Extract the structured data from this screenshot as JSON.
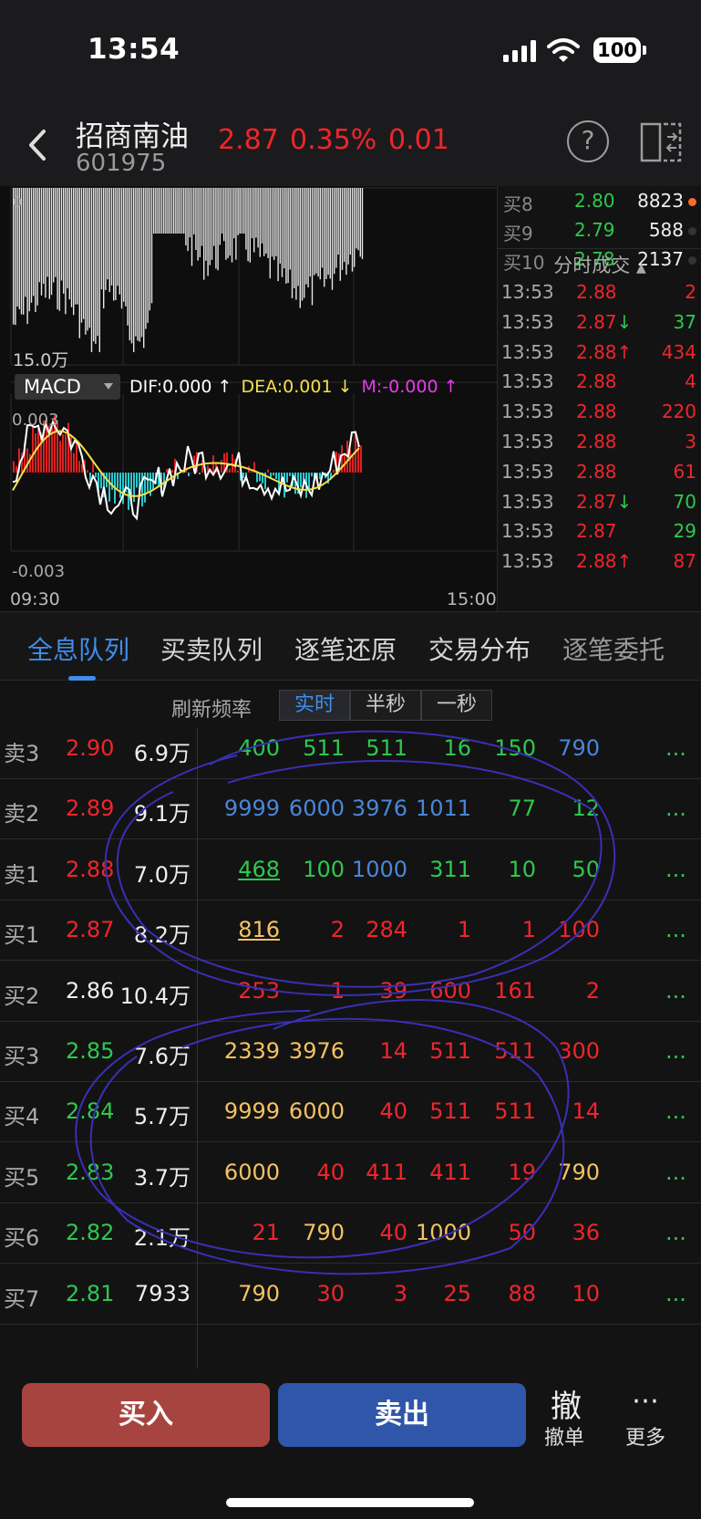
{
  "status_bar": {
    "time": "13:54",
    "battery": "100"
  },
  "header": {
    "stock_name": "招商南油",
    "stock_code": "601975",
    "price": "2.87",
    "change_pct": "0.35%",
    "change": "0.01"
  },
  "chart": {
    "volume_label": "15.0万",
    "volume_zero": "0",
    "macd_select": "MACD",
    "dif": "DIF:0.000 ↑",
    "dea": "DEA:0.001 ↓",
    "m": "M:-0.000 ↑",
    "macd_top": "0.003",
    "macd_bottom": "-0.003",
    "time_start": "09:30",
    "time_end": "15:00",
    "colors": {
      "dif": "#ffffff",
      "dea": "#f4e04a",
      "m": "#e83be8",
      "up": "#e02020",
      "down": "#28c8d0"
    }
  },
  "order_book_top": [
    {
      "label": "买8",
      "price": "2.80",
      "volume": "8823",
      "dot": "#ff6a2a"
    },
    {
      "label": "买9",
      "price": "2.79",
      "volume": "588",
      "dot": "#333333"
    },
    {
      "label": "买10",
      "price": "2.78",
      "volume": "2137",
      "dot": "#333333"
    }
  ],
  "ticks": {
    "title": "分时成交",
    "rows": [
      {
        "time": "13:53",
        "price": "2.88",
        "arrow": "",
        "amount": "2",
        "dir": "up"
      },
      {
        "time": "13:53",
        "price": "2.87↓",
        "arrow": "",
        "amount": "37",
        "dir": "down"
      },
      {
        "time": "13:53",
        "price": "2.88↑",
        "arrow": "",
        "amount": "434",
        "dir": "up"
      },
      {
        "time": "13:53",
        "price": "2.88",
        "arrow": "",
        "amount": "4",
        "dir": "up"
      },
      {
        "time": "13:53",
        "price": "2.88",
        "arrow": "",
        "amount": "220",
        "dir": "up"
      },
      {
        "time": "13:53",
        "price": "2.88",
        "arrow": "",
        "amount": "3",
        "dir": "up"
      },
      {
        "time": "13:53",
        "price": "2.88",
        "arrow": "",
        "amount": "61",
        "dir": "up"
      },
      {
        "time": "13:53",
        "price": "2.87↓",
        "arrow": "",
        "amount": "70",
        "dir": "down"
      },
      {
        "time": "13:53",
        "price": "2.87",
        "arrow": "",
        "amount": "29",
        "dir": "down"
      },
      {
        "time": "13:53",
        "price": "2.88↑",
        "arrow": "",
        "amount": "87",
        "dir": "up"
      }
    ]
  },
  "tabs": [
    "全息队列",
    "买卖队列",
    "逐笔还原",
    "交易分布",
    "逐笔委托"
  ],
  "refresh": {
    "label": "刷新频率",
    "options": [
      "实时",
      "半秒",
      "一秒"
    ]
  },
  "queue": [
    {
      "label": "卖3",
      "price": "2.90",
      "pc": "cr",
      "vol": "6.9万",
      "cells": [
        [
          "400",
          "cg"
        ],
        [
          "511",
          "cg"
        ],
        [
          "511",
          "cg"
        ],
        [
          "16",
          "cg"
        ],
        [
          "150",
          "cg"
        ],
        [
          "790",
          "cb"
        ]
      ]
    },
    {
      "label": "卖2",
      "price": "2.89",
      "pc": "cr",
      "vol": "9.1万",
      "cells": [
        [
          "9999",
          "cb"
        ],
        [
          "6000",
          "cb"
        ],
        [
          "3976",
          "cb"
        ],
        [
          "1011",
          "cb"
        ],
        [
          "77",
          "cg"
        ],
        [
          "12",
          "cg"
        ]
      ]
    },
    {
      "label": "卖1",
      "price": "2.88",
      "pc": "cr",
      "vol": "7.0万",
      "cells": [
        [
          "468",
          "cg ul"
        ],
        [
          "100",
          "cg"
        ],
        [
          "1000",
          "cb"
        ],
        [
          "311",
          "cg"
        ],
        [
          "10",
          "cg"
        ],
        [
          "50",
          "cg"
        ]
      ]
    },
    {
      "label": "买1",
      "price": "2.87",
      "pc": "cr",
      "vol": "8.2万",
      "cells": [
        [
          "816",
          "cy ul"
        ],
        [
          "2",
          "cr"
        ],
        [
          "284",
          "cr"
        ],
        [
          "1",
          "cr"
        ],
        [
          "1",
          "cr"
        ],
        [
          "100",
          "cr"
        ]
      ]
    },
    {
      "label": "买2",
      "price": "2.86",
      "pc": "cw",
      "vol": "10.4万",
      "cells": [
        [
          "253",
          "cr"
        ],
        [
          "1",
          "cr"
        ],
        [
          "39",
          "cr"
        ],
        [
          "600",
          "cr"
        ],
        [
          "161",
          "cr"
        ],
        [
          "2",
          "cr"
        ]
      ]
    },
    {
      "label": "买3",
      "price": "2.85",
      "pc": "cg",
      "vol": "7.6万",
      "cells": [
        [
          "2339",
          "cy"
        ],
        [
          "3976",
          "cy"
        ],
        [
          "14",
          "cr"
        ],
        [
          "511",
          "cr"
        ],
        [
          "511",
          "cr"
        ],
        [
          "300",
          "cr"
        ]
      ]
    },
    {
      "label": "买4",
      "price": "2.84",
      "pc": "cg",
      "vol": "5.7万",
      "cells": [
        [
          "9999",
          "cy"
        ],
        [
          "6000",
          "cy"
        ],
        [
          "40",
          "cr"
        ],
        [
          "511",
          "cr"
        ],
        [
          "511",
          "cr"
        ],
        [
          "14",
          "cr"
        ]
      ]
    },
    {
      "label": "买5",
      "price": "2.83",
      "pc": "cg",
      "vol": "3.7万",
      "cells": [
        [
          "6000",
          "cy"
        ],
        [
          "40",
          "cr"
        ],
        [
          "411",
          "cr"
        ],
        [
          "411",
          "cr"
        ],
        [
          "19",
          "cr"
        ],
        [
          "790",
          "cy"
        ]
      ]
    },
    {
      "label": "买6",
      "price": "2.82",
      "pc": "cg",
      "vol": "2.1万",
      "cells": [
        [
          "21",
          "cr"
        ],
        [
          "790",
          "cy"
        ],
        [
          "40",
          "cr"
        ],
        [
          "1000",
          "cy"
        ],
        [
          "50",
          "cr"
        ],
        [
          "36",
          "cr"
        ]
      ]
    },
    {
      "label": "买7",
      "price": "2.81",
      "pc": "cg",
      "vol": "7933",
      "cells": [
        [
          "790",
          "cy"
        ],
        [
          "30",
          "cr"
        ],
        [
          "3",
          "cr"
        ],
        [
          "25",
          "cr"
        ],
        [
          "88",
          "cr"
        ],
        [
          "10",
          "cr"
        ]
      ]
    }
  ],
  "more_glyph": "...",
  "bottom": {
    "buy": "买入",
    "sell": "卖出",
    "cancel_icon": "撤",
    "cancel": "撤单",
    "more_icon": "⋯",
    "more": "更多"
  }
}
